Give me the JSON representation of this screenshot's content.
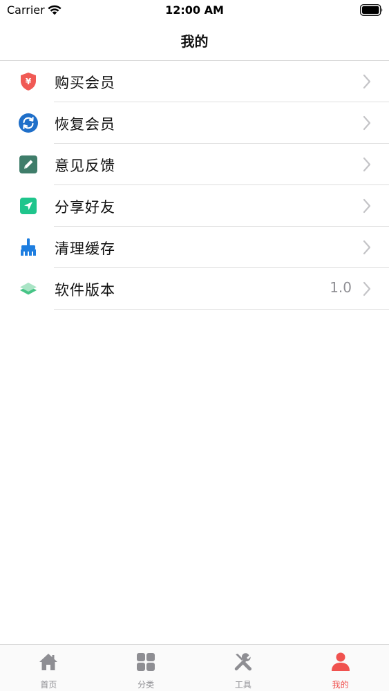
{
  "status_bar": {
    "carrier": "Carrier",
    "time": "12:00 AM"
  },
  "nav": {
    "title": "我的"
  },
  "menu": {
    "items": [
      {
        "label": "购买会员",
        "icon": "shield-yen-icon",
        "color": "#f05a55"
      },
      {
        "label": "恢复会员",
        "icon": "refresh-icon",
        "color": "#1f6fc9"
      },
      {
        "label": "意见反馈",
        "icon": "edit-pencil-icon",
        "color": "#3f7d6a"
      },
      {
        "label": "分享好友",
        "icon": "share-arrow-icon",
        "color": "#1fc58c"
      },
      {
        "label": "清理缓存",
        "icon": "broom-icon",
        "color": "#1e7ee0"
      },
      {
        "label": "软件版本",
        "icon": "layers-icon",
        "color": "#46c486",
        "value": "1.0"
      }
    ]
  },
  "tab_bar": {
    "tabs": [
      {
        "label": "首页",
        "icon": "home-icon",
        "active": false
      },
      {
        "label": "分类",
        "icon": "grid-icon",
        "active": false
      },
      {
        "label": "工具",
        "icon": "tools-icon",
        "active": false
      },
      {
        "label": "我的",
        "icon": "person-icon",
        "active": true
      }
    ],
    "active_color": "#f0524f",
    "inactive_color": "#8e8e93"
  }
}
